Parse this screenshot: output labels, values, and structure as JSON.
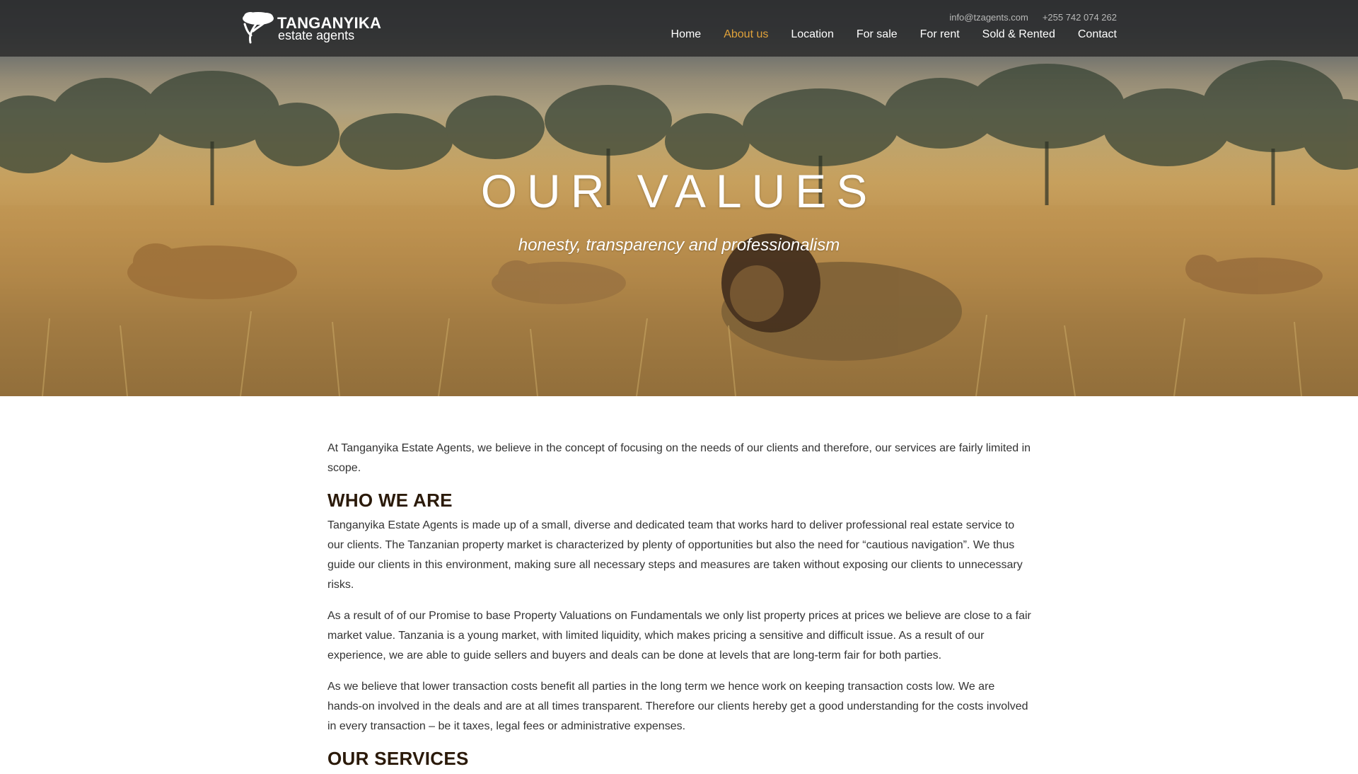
{
  "header": {
    "logo": {
      "name": "TANGANYIKA",
      "tagline": "estate agents"
    },
    "email": "info@tzagents.com",
    "phone": "+255 742 074 262",
    "nav": [
      {
        "label": "Home",
        "active": false
      },
      {
        "label": "About us",
        "active": true
      },
      {
        "label": "Location",
        "active": false
      },
      {
        "label": "For sale",
        "active": false
      },
      {
        "label": "For rent",
        "active": false
      },
      {
        "label": "Sold & Rented",
        "active": false
      },
      {
        "label": "Contact",
        "active": false
      }
    ],
    "colors": {
      "active_nav": "#e0a23a",
      "bar": "#2d2d2d"
    }
  },
  "hero": {
    "title": "OUR VALUES",
    "subtitle": "honesty, transparency and professionalism"
  },
  "content": {
    "intro": "At Tanganyika Estate Agents, we believe in the concept of focusing on the needs of our clients and therefore, our services are fairly limited in scope.",
    "who_we_are": {
      "heading": "WHO WE ARE",
      "paragraphs": [
        "Tanganyika Estate Agents is made up of a small, diverse and dedicated team that works hard to deliver professional real estate service to our clients. The Tanzanian property market is characterized by plenty of opportunities but also the need for “cautious navigation”. We thus guide our clients in this environment, making sure all necessary steps and measures are taken without exposing our clients to unnecessary risks.",
        "As a result of of our Promise to base Property Valuations on Fundamentals we only list property prices at prices we believe are close to a fair market value. Tanzania is a young market, with limited liquidity, which makes pricing a sensitive and difficult issue. As a result of our experience, we are able to guide sellers and buyers and deals can be done at levels that are long-term fair for both parties.",
        "As we believe that lower transaction costs benefit all parties in the long term we  hence work on keeping transaction costs low. We are hands-on involved in the deals and are at all times transparent. Therefore our clients hereby get a good understanding for the costs involved in every transaction – be it taxes, legal fees or administrative expenses."
      ]
    },
    "our_services": {
      "heading": "OUR SERVICES"
    }
  }
}
